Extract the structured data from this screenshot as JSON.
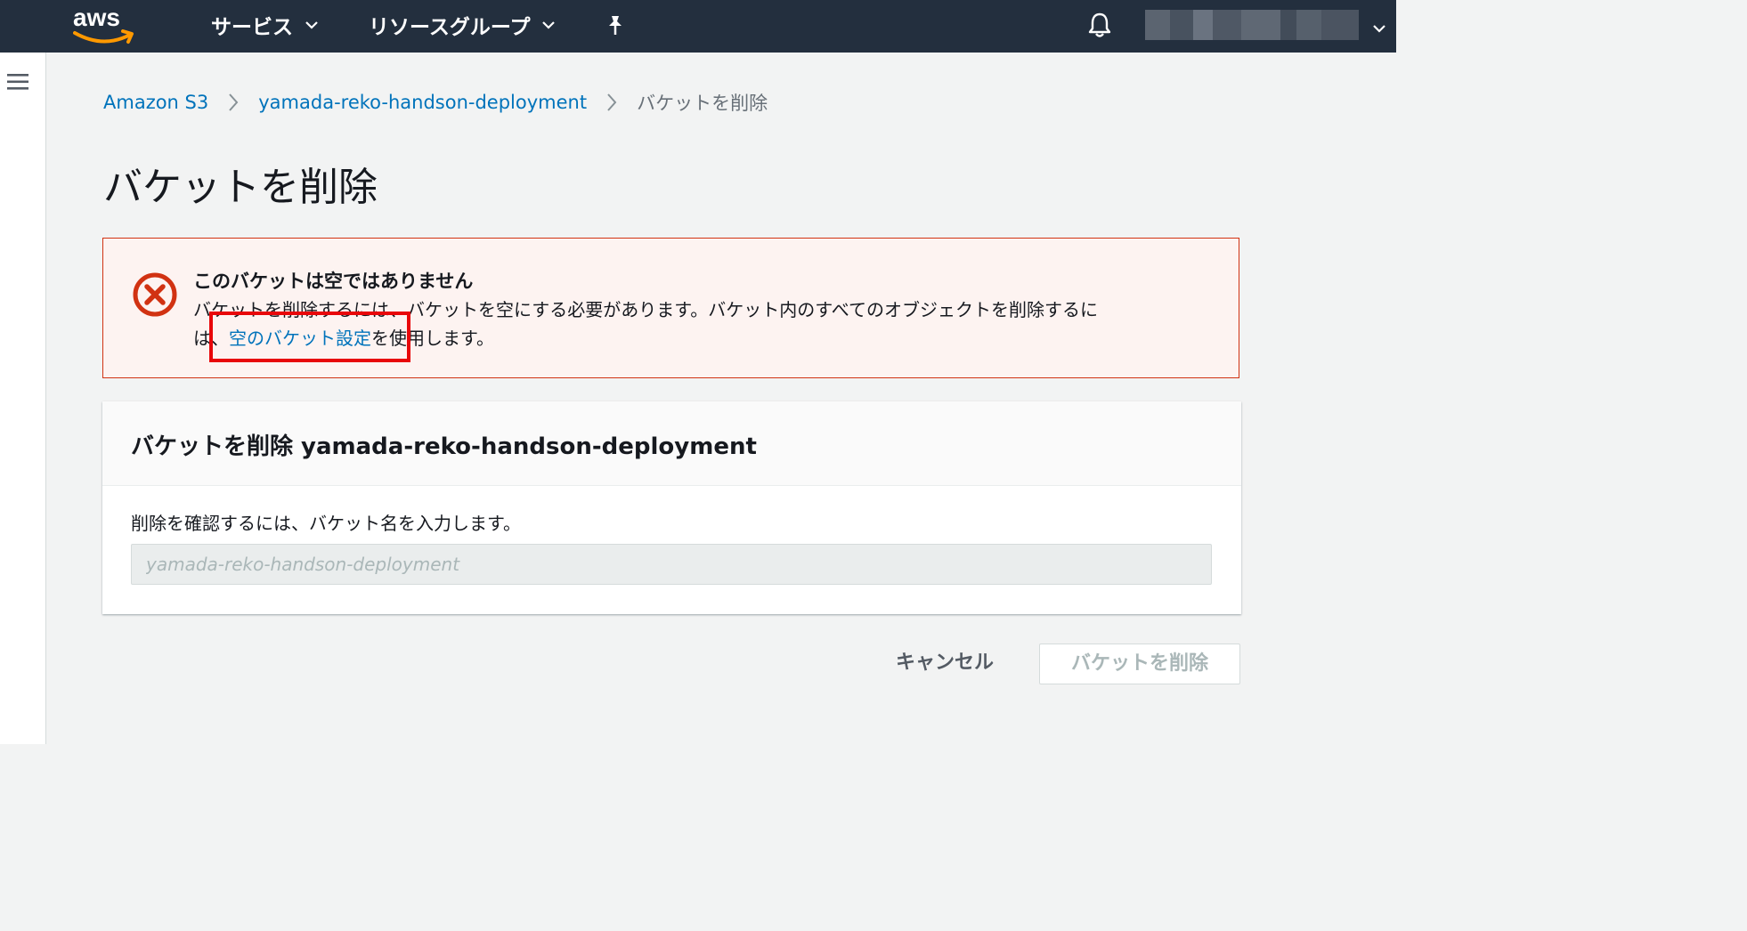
{
  "topbar": {
    "logo_text": "aws",
    "services_label": "サービス",
    "resource_groups_label": "リソースグループ"
  },
  "breadcrumb": {
    "items": [
      {
        "label": "Amazon S3"
      },
      {
        "label": "yamada-reko-handson-deployment"
      },
      {
        "label": "バケットを削除"
      }
    ]
  },
  "page": {
    "title": "バケットを削除"
  },
  "alert": {
    "title": "このバケットは空ではありません",
    "body_line1": "バケットを削除するには、バケットを空にする必要があります。バケット内のすべてのオブジェクトを削除するに",
    "body_line2_prefix": "は、",
    "link_text": "空のバケット設定",
    "body_line2_suffix": "を使用します。"
  },
  "panel": {
    "title": "バケットを削除 yamada-reko-handson-deployment",
    "confirm_label": "削除を確認するには、バケット名を入力します。",
    "input_placeholder": "yamada-reko-handson-deployment",
    "input_value": ""
  },
  "actions": {
    "cancel_label": "キャンセル",
    "delete_label": "バケットを削除"
  },
  "colors": {
    "topbar_bg": "#232f3e",
    "link": "#0073bb",
    "error": "#d13212",
    "error_bg": "#fdf3f1",
    "highlight": "#e8070a",
    "aws_smile": "#ff9900"
  }
}
